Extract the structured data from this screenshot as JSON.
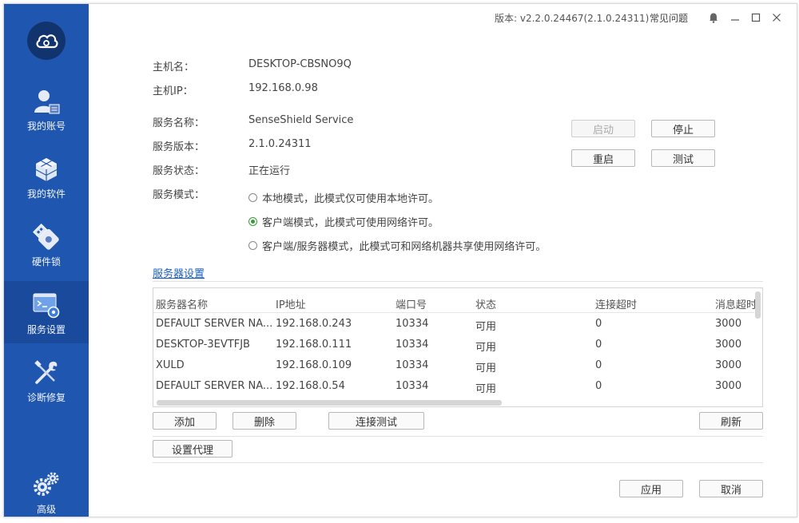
{
  "titlebar": {
    "version": "版本: v2.2.0.24467(2.1.0.24311)",
    "faq": "常见问题"
  },
  "sidebar": {
    "items": [
      {
        "label": "我的账号",
        "icon": "user-icon"
      },
      {
        "label": "我的软件",
        "icon": "cubes-icon"
      },
      {
        "label": "硬件锁",
        "icon": "usb-key-icon"
      },
      {
        "label": "服务设置",
        "icon": "terminal-settings-icon"
      },
      {
        "label": "诊断修复",
        "icon": "tools-icon"
      },
      {
        "label": "高级",
        "icon": "gears-icon"
      }
    ]
  },
  "host": {
    "name_label": "主机名：",
    "name_value": "DESKTOP-CBSNO9Q",
    "ip_label": "主机IP：",
    "ip_value": "192.168.0.98"
  },
  "service": {
    "name_label": "服务名称：",
    "name_value": "SenseShield Service",
    "version_label": "服务版本：",
    "version_value": "2.1.0.24311",
    "status_label": "服务状态：",
    "status_value": "正在运行",
    "mode_label": "服务模式：",
    "modes": [
      {
        "label": "本地模式，此模式仅可使用本地许可。",
        "selected": false
      },
      {
        "label": "客户端模式，此模式可使用网络许可。",
        "selected": true
      },
      {
        "label": "客户端/服务器模式，此模式可和网络机器共享使用网络许可。",
        "selected": false
      }
    ],
    "buttons": {
      "start": "启动",
      "stop": "停止",
      "restart": "重启",
      "test": "测试"
    }
  },
  "server_settings": {
    "link": "服务器设置",
    "columns": [
      "服务器名称",
      "IP地址",
      "端口号",
      "状态",
      "连接超时",
      "消息超时"
    ],
    "rows": [
      [
        "DEFAULT SERVER NA...",
        "192.168.0.243",
        "10334",
        "可用",
        "0",
        "3000"
      ],
      [
        "DESKTOP-3EVTFJB",
        "192.168.0.111",
        "10334",
        "可用",
        "0",
        "3000"
      ],
      [
        "XULD",
        "192.168.0.109",
        "10334",
        "可用",
        "0",
        "3000"
      ],
      [
        "DEFAULT SERVER NA...",
        "192.168.0.54",
        "10334",
        "可用",
        "0",
        "3000"
      ]
    ],
    "buttons": {
      "add": "添加",
      "delete": "删除",
      "conn_test": "连接测试",
      "refresh": "刷新",
      "proxy": "设置代理"
    }
  },
  "footer": {
    "apply": "应用",
    "cancel": "取消"
  }
}
